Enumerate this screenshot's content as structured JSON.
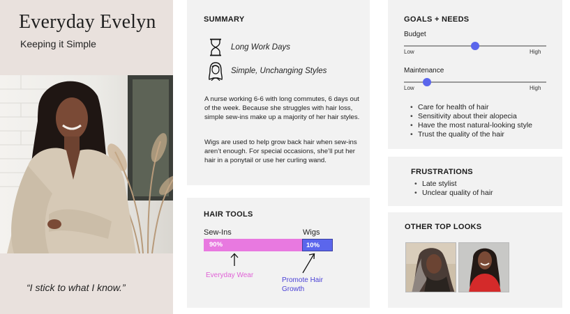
{
  "persona": {
    "name": "Everyday Evelyn",
    "tagline": "Keeping it Simple",
    "quote": "“I stick to what I know.”"
  },
  "summary": {
    "title": "SUMMARY",
    "items": [
      {
        "icon": "hourglass-icon",
        "label": "Long Work Days"
      },
      {
        "icon": "woman-long-hair-icon",
        "label": "Simple, Unchanging Styles"
      }
    ],
    "paragraphs": [
      "A nurse working 6-6 with long commutes, 6 days out of the week. Because she struggles with hair loss, simple sew-ins make up a majority of her hair styles.",
      "Wigs are used to help grow back hair when sew-ins aren’t enough. For special occasions, she’ll put her hair in a ponytail or use her curling wand."
    ]
  },
  "hair_tools": {
    "title": "HAIR TOOLS",
    "tools": [
      {
        "label": "Sew-Ins",
        "share_label": "90%",
        "share": 0.9,
        "note": "Everyday Wear",
        "color": "#e879e0"
      },
      {
        "label": "Wigs",
        "share_label": "10%",
        "share": 0.1,
        "note": "Promote Hair Growth",
        "color": "#5b66ec"
      }
    ]
  },
  "goals": {
    "title": "GOALS + NEEDS",
    "sliders": [
      {
        "label": "Budget",
        "low": "Low",
        "high": "High",
        "value": 0.5
      },
      {
        "label": "Maintenance",
        "low": "Low",
        "high": "High",
        "value": 0.16
      }
    ],
    "needs": [
      "Care for health of hair",
      "Sensitivity about their alopecia",
      "Have the most natural-looking style",
      "Trust the quality of the hair"
    ]
  },
  "frustrations": {
    "title": "FRUSTRATIONS",
    "items": [
      "Late stylist",
      "Unclear quality of hair"
    ]
  },
  "other_looks": {
    "title": "OTHER TOP LOOKS"
  },
  "colors": {
    "card_bg": "#f2f2f2",
    "persona_bg": "#e9e1dd",
    "pink": "#e879e0",
    "blue": "#5b66ec",
    "wig_note": "#4b42d6"
  }
}
